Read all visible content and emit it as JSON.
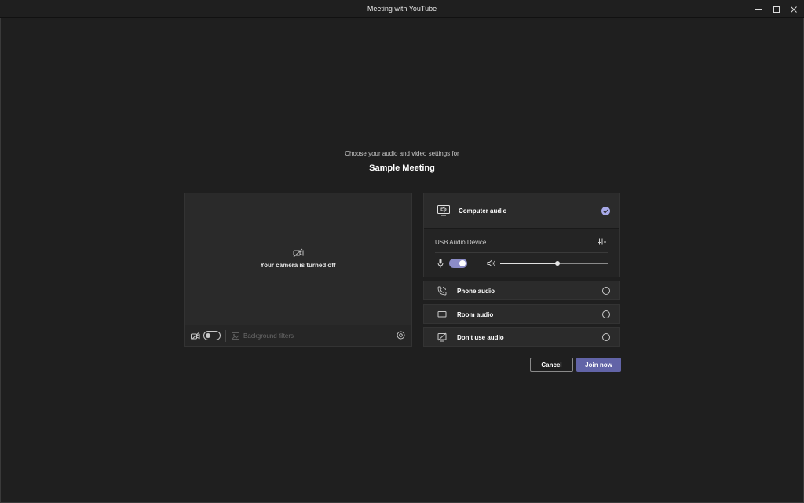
{
  "window": {
    "title": "Meeting with YouTube",
    "controls": [
      "minimize-icon",
      "maximize-icon",
      "close-icon"
    ]
  },
  "prejoin": {
    "subtitle": "Choose your audio and video settings for",
    "meeting_name": "Sample Meeting"
  },
  "video": {
    "camera_off_text": "Your camera is turned off",
    "camera_toggle": "off",
    "background_filters_label": "Background filters"
  },
  "audio": {
    "computer_audio": {
      "label": "Computer audio",
      "selected": true,
      "device_label": "USB Audio Device",
      "mic_toggle": "on",
      "speaker_volume_percent": 53
    },
    "options": [
      {
        "label": "Phone audio",
        "icon": "phone-audio-icon",
        "selected": false
      },
      {
        "label": "Room audio",
        "icon": "room-audio-icon",
        "selected": false
      },
      {
        "label": "Don't use audio",
        "icon": "no-audio-icon",
        "selected": false
      }
    ]
  },
  "actions": {
    "cancel_label": "Cancel",
    "join_label": "Join now"
  },
  "colors": {
    "background": "#1f1f1f",
    "panel": "#2b2b2b",
    "accent": "#6264a7",
    "toggle_on": "#8b8cc7",
    "check": "#a7a9e8"
  }
}
